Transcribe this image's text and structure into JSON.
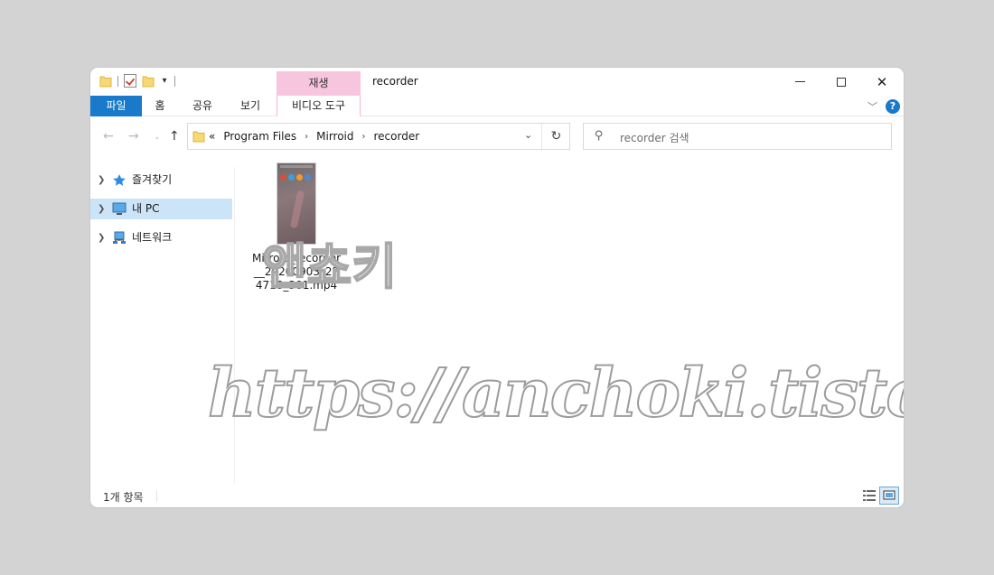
{
  "window": {
    "title": "recorder"
  },
  "ribbon": {
    "context_tab": "재생",
    "tabs": [
      "파일",
      "홈",
      "공유",
      "보기",
      "비디오 도구"
    ]
  },
  "address": {
    "overflow": "«",
    "crumbs": [
      "Program Files",
      "Mirroid",
      "recorder"
    ]
  },
  "search": {
    "placeholder": "recorder 검색"
  },
  "navpane": {
    "items": [
      {
        "label": "즐겨찾기",
        "icon": "star-icon"
      },
      {
        "label": "내 PC",
        "icon": "computer-icon"
      },
      {
        "label": "네트워크",
        "icon": "network-icon"
      }
    ]
  },
  "files": [
    {
      "name": "Mirroid_recorder__20200903_224718_301.mp4"
    }
  ],
  "status": {
    "count": "1개 항목"
  },
  "watermark": {
    "url": "https://anchoki.tistory.com",
    "mark": "앤쵸키"
  },
  "colors": {
    "file_tab": "#1979ca",
    "context_tab": "#f7c6de",
    "selected": "#cce4f7"
  }
}
